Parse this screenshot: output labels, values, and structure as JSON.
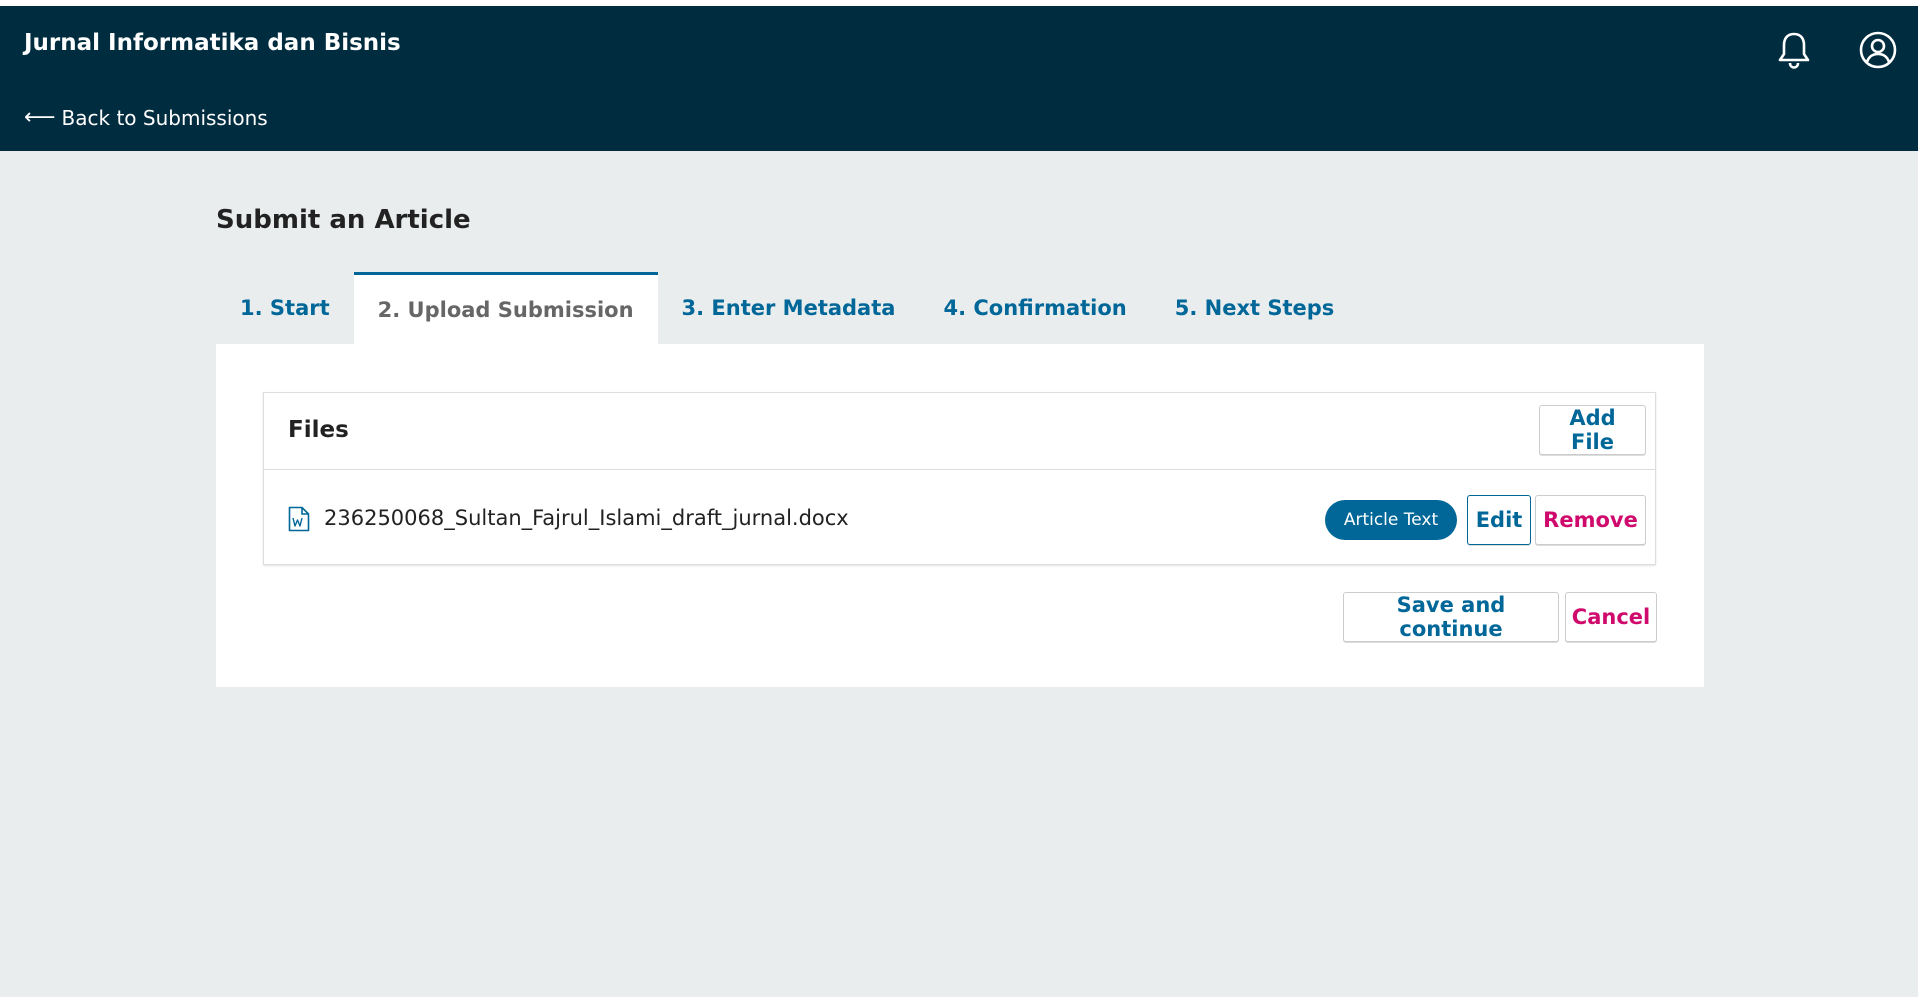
{
  "header": {
    "site_title": "Jurnal Informatika dan Bisnis",
    "back_link": "Back to Submissions",
    "back_arrow": "⟵",
    "icons": [
      "bell-icon",
      "user-icon"
    ]
  },
  "page": {
    "title": "Submit an Article",
    "tabs": [
      {
        "label": "1. Start",
        "active": false
      },
      {
        "label": "2. Upload Submission",
        "active": true
      },
      {
        "label": "3. Enter Metadata",
        "active": false
      },
      {
        "label": "4. Confirmation",
        "active": false
      },
      {
        "label": "5. Next Steps",
        "active": false
      }
    ]
  },
  "files": {
    "title": "Files",
    "add_file_label": "Add File",
    "items": [
      {
        "name": "236250068_Sultan_Fajrul_Islami_draft_jurnal.docx",
        "icon": "word-file-icon",
        "genre": "Article Text",
        "edit_label": "Edit",
        "remove_label": "Remove"
      }
    ]
  },
  "actions": {
    "save_label": "Save and continue",
    "cancel_label": "Cancel"
  },
  "colors": {
    "header_bg": "#002c40",
    "page_bg": "#e9edee",
    "primary": "#006798",
    "danger": "#d00a6c"
  }
}
